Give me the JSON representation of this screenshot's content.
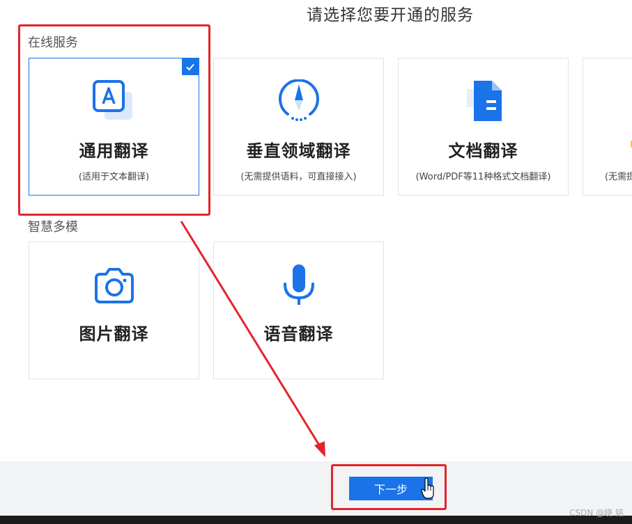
{
  "page": {
    "title": "请选择您要开通的服务"
  },
  "sections": {
    "online": {
      "label": "在线服务"
    },
    "smart": {
      "label": "智慧多模"
    }
  },
  "cards": {
    "general": {
      "title": "通用翻译",
      "subtitle": "(适用于文本翻译)",
      "icon": "text-a-icon",
      "selected": true
    },
    "vertical": {
      "title": "垂直领域翻译",
      "subtitle": "(无需提供语料，可直接接入)",
      "icon": "compass-icon",
      "selected": false
    },
    "document": {
      "title": "文档翻译",
      "subtitle": "(Word/PDF等11种格式文档翻译)",
      "icon": "document-icon",
      "selected": false
    },
    "partial": {
      "subtitle": "(无需提"
    },
    "image": {
      "title": "图片翻译",
      "icon": "camera-icon",
      "selected": false
    },
    "voice": {
      "title": "语音翻译",
      "icon": "microphone-icon",
      "selected": false
    }
  },
  "footer": {
    "next_label": "下一步"
  },
  "watermark": "CSDN @晓  铭",
  "colors": {
    "accent": "#1a73e8",
    "annotation": "#e3242b",
    "footer_bg": "#f2f3f5"
  }
}
